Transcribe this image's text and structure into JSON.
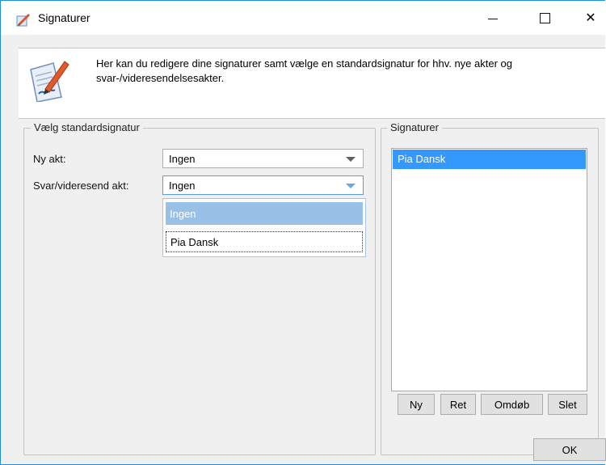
{
  "window": {
    "title": "Signaturer"
  },
  "header": {
    "text": "Her kan du redigere dine signaturer samt vælge en standardsignatur for hhv. nye akter og svar-/videresendelsesakter."
  },
  "standard_group": {
    "legend": "Vælg standardsignatur",
    "new_label": "Ny akt:",
    "new_value": "Ingen",
    "reply_label": "Svar/videresend akt:",
    "reply_value": "Ingen",
    "dropdown_options": [
      "Ingen",
      "Pia Dansk"
    ]
  },
  "signatures_group": {
    "legend": "Signaturer",
    "items": [
      "Pia Dansk"
    ],
    "buttons": {
      "new": "Ny",
      "edit": "Ret",
      "rename": "Omdøb",
      "delete": "Slet"
    }
  },
  "footer": {
    "ok_label": "OK"
  },
  "icons": {
    "app": "signature-pen-icon",
    "header": "signature-document-icon"
  },
  "colors": {
    "selection": "#3399ff",
    "dropdown_highlight": "#99c1e8",
    "window_border": "#1e8fe0"
  }
}
